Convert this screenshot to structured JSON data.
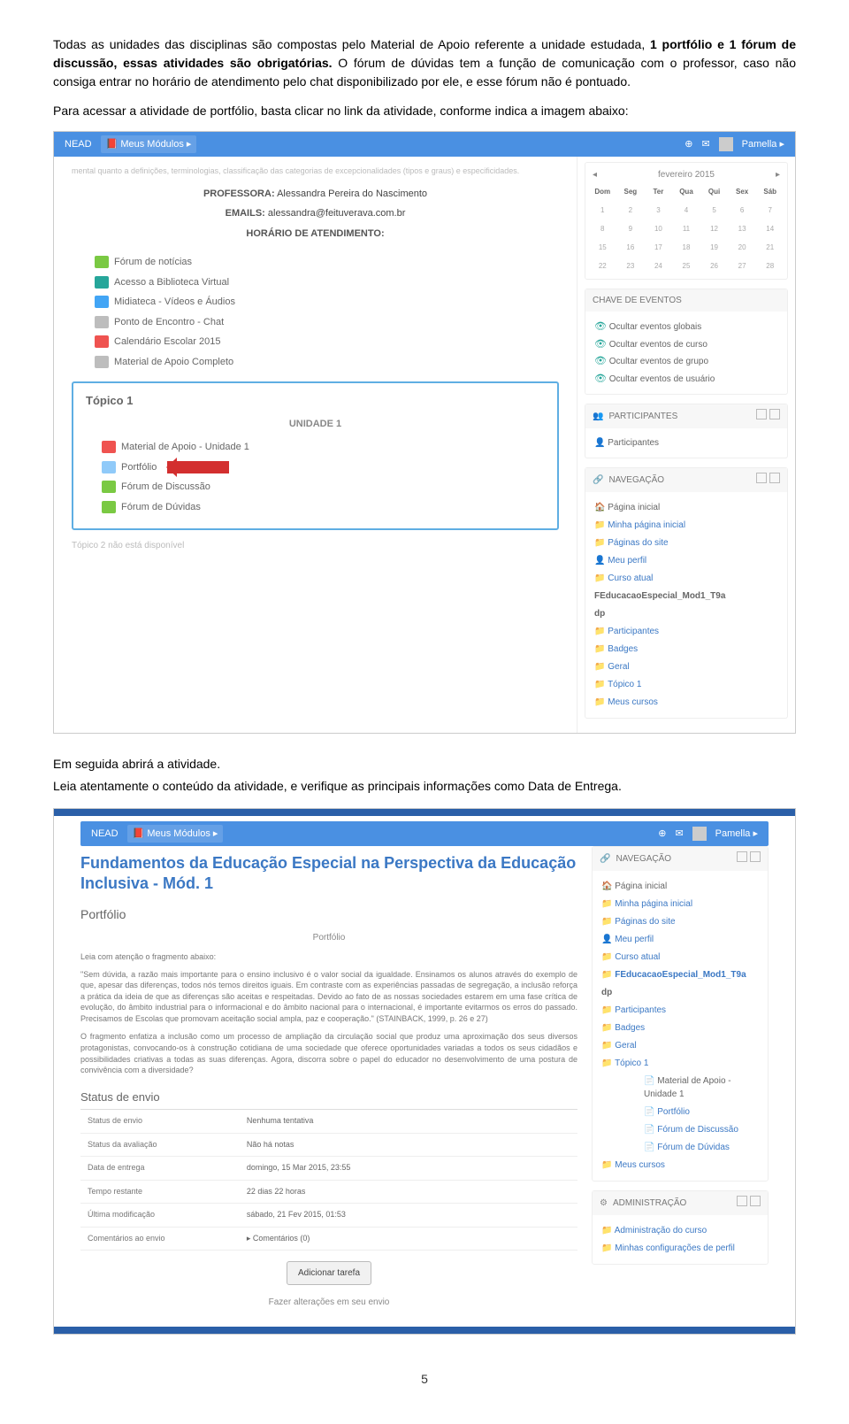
{
  "intro": {
    "p1a": "Todas as unidades das disciplinas são compostas pelo Material de Apoio referente a unidade estudada, ",
    "p1b": "1 portfólio e 1 fórum de discussão, essas atividades são obrigatórias.",
    "p1c": " O fórum de dúvidas tem a função de comunicação com o professor, caso não consiga entrar no horário de atendimento pelo chat disponibilizado por ele, e esse fórum não é pontuado.",
    "p2": "Para acessar a atividade de portfólio, basta clicar no link da atividade, conforme indica a imagem abaixo:"
  },
  "s1": {
    "nead": "NEAD",
    "meus_modulos": "Meus Módulos",
    "user": "Pamella",
    "top_fade": "mental quanto a definições, terminologias, classificação das categorias de excepcionalidades (tipos e graus) e especificidades.",
    "prof_label": "PROFESSORA:",
    "prof_name": "Alessandra Pereira do Nascimento",
    "emails_label": "EMAILS:",
    "emails_val": "alessandra@feituverava.com.br",
    "hor_label": "HORÁRIO DE ATENDIMENTO:",
    "res": [
      "Fórum de notícias",
      "Acesso a Biblioteca Virtual",
      "Midiateca - Vídeos e Áudios",
      "Ponto de Encontro - Chat",
      "Calendário Escolar 2015",
      "Material de Apoio Completo"
    ],
    "topic_title": "Tópico 1",
    "unidade": "UNIDADE 1",
    "t_items": [
      "Material de Apoio - Unidade 1",
      "Portfólio",
      "Fórum de Discussão",
      "Fórum de Dúvidas"
    ],
    "topic2": "Tópico 2 não está disponível",
    "cal_month": "fevereiro 2015",
    "dow": [
      "Dom",
      "Seg",
      "Ter",
      "Qua",
      "Qui",
      "Sex",
      "Sáb"
    ],
    "chave_hd": "CHAVE DE EVENTOS",
    "chave": [
      "Ocultar eventos globais",
      "Ocultar eventos de curso",
      "Ocultar eventos de grupo",
      "Ocultar eventos de usuário"
    ],
    "part_hd": "PARTICIPANTES",
    "part_item": "Participantes",
    "nav_hd": "NAVEGAÇÃO",
    "nav": {
      "a": "Página inicial",
      "b": "Minha página inicial",
      "c": "Páginas do site",
      "d": "Meu perfil",
      "e": "Curso atual",
      "f": "FEducacaoEspecial_Mod1_T9a",
      "g": "dp",
      "h": "Participantes",
      "i": "Badges",
      "j": "Geral",
      "k": "Tópico 1",
      "l": "Meus cursos"
    }
  },
  "mid": {
    "p1": "Em seguida abrirá a atividade.",
    "p2": "Leia atentamente o conteúdo da atividade, e verifique as principais informações como Data de Entrega."
  },
  "s2": {
    "nead": "NEAD",
    "meus_modulos": "Meus Módulos",
    "user": "Pamella",
    "title": "Fundamentos da Educação Especial na Perspectiva da Educação Inclusiva - Mód. 1",
    "port": "Portfólio",
    "port_cent": "Portfólio",
    "lead": "Leia com atenção o fragmento abaixo:",
    "frag": "\"Sem dúvida, a razão mais importante para o ensino inclusivo é o valor social da igualdade. Ensinamos os alunos através do exemplo de que, apesar das diferenças, todos nós temos direitos iguais. Em contraste com as experiências passadas de segregação, a inclusão reforça a prática da ideia de que as diferenças são aceitas e respeitadas. Devido ao fato de as nossas sociedades estarem em uma fase crítica de evolução, do âmbito industrial para o informacional e do âmbito nacional para o internacional, é importante evitarmos os erros do passado. Precisamos de Escolas que promovam aceitação social ampla, paz e cooperação.\" (STAINBACK, 1999, p. 26 e 27)",
    "frag2": "O fragmento enfatiza a inclusão como um processo de ampliação da circulação social que produz uma aproximação dos seus diversos protagonistas, convocando-os à construção cotidiana de uma sociedade que oferece oportunidades variadas a todos os seus cidadãos e possibilidades criativas a todas as suas diferenças. Agora, discorra sobre o papel do educador no desenvolvimento de uma postura de convivência com a diversidade?",
    "status_hd": "Status de envio",
    "rows": [
      [
        "Status de envio",
        "Nenhuma tentativa"
      ],
      [
        "Status da avaliação",
        "Não há notas"
      ],
      [
        "Data de entrega",
        "domingo, 15 Mar 2015, 23:55"
      ],
      [
        "Tempo restante",
        "22 dias 22 horas"
      ],
      [
        "Última modificação",
        "sábado, 21 Fev 2015, 01:53"
      ],
      [
        "Comentários ao envio",
        "▸ Comentários (0)"
      ]
    ],
    "btn": "Adicionar tarefa",
    "btn_sub": "Fazer alterações em seu envio",
    "nav_hd": "NAVEGAÇÃO",
    "nav": {
      "a": "Página inicial",
      "b": "Minha página inicial",
      "c": "Páginas do site",
      "d": "Meu perfil",
      "e": "Curso atual",
      "f": "FEducacaoEspecial_Mod1_T9a",
      "g": "dp",
      "h": "Participantes",
      "i": "Badges",
      "j": "Geral",
      "k": "Tópico 1",
      "k1": "Material de Apoio - Unidade 1",
      "k2": "Portfólio",
      "k3": "Fórum de Discussão",
      "k4": "Fórum de Dúvidas",
      "l": "Meus cursos"
    },
    "adm_hd": "ADMINISTRAÇÃO",
    "adm1": "Administração do curso",
    "adm2": "Minhas configurações de perfil"
  },
  "pageno": "5"
}
